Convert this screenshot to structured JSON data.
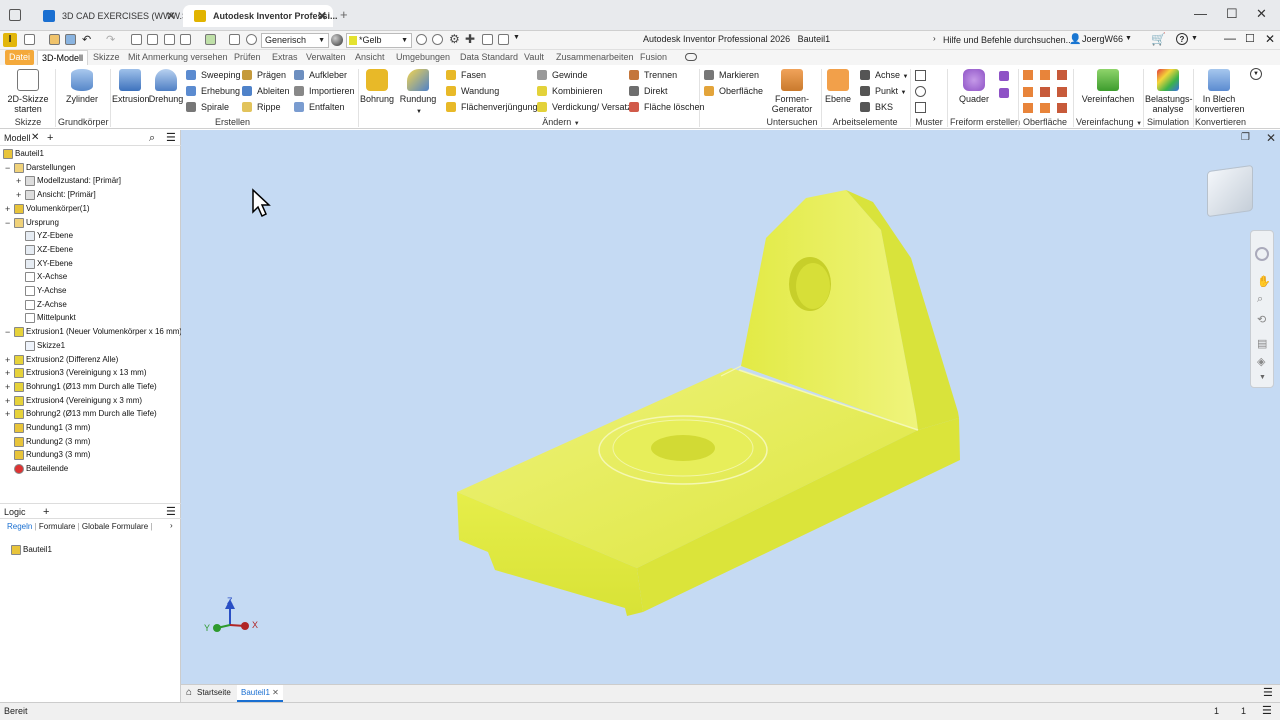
{
  "browser": {
    "tabs": [
      {
        "label": "3D CAD EXERCISES (WWW.S..."
      },
      {
        "label": "Autodesk Inventor Professi..."
      }
    ]
  },
  "app": {
    "title": "Autodesk Inventor Professional 2026",
    "document": "Bauteil1",
    "search_placeholder": "Hilfe und Befehle durchsuchen...",
    "user": "JoergW66"
  },
  "quick_access": {
    "appearance_combo": "Generisch",
    "color_combo": "*Gelb"
  },
  "ribbon_tabs": [
    "Datei",
    "3D-Modell",
    "Skizze",
    "Mit Anmerkung versehen",
    "Prüfen",
    "Extras",
    "Verwalten",
    "Ansicht",
    "Umgebungen",
    "Data Standard",
    "Vault",
    "Zusammenarbeiten",
    "Fusion"
  ],
  "ribbon": {
    "skizze": {
      "sketch_btn": "2D-Skizze starten",
      "group": "Skizze"
    },
    "grundkoerper": {
      "zylinder": "Zylinder",
      "group": "Grundkörper"
    },
    "erstellen": {
      "extrusion": "Extrusion",
      "drehung": "Drehung",
      "sweeping": "Sweeping",
      "erhebung": "Erhebung",
      "spirale": "Spirale",
      "praegen": "Prägen",
      "ableiten": "Ableiten",
      "rippe": "Rippe",
      "aufkleber": "Aufkleber",
      "importieren": "Importieren",
      "entfalten": "Entfalten",
      "group": "Erstellen"
    },
    "aendern": {
      "bohrung": "Bohrung",
      "rundung": "Rundung",
      "fasen": "Fasen",
      "wandung": "Wandung",
      "flaechenverjuengung": "Flächenverjüngung",
      "gewinde": "Gewinde",
      "kombinieren": "Kombinieren",
      "verdickung": "Verdickung/ Versatz",
      "trennen": "Trennen",
      "direkt": "Direkt",
      "flaeche_loeschen": "Fläche löschen",
      "group": "Ändern"
    },
    "untersuchen": {
      "markieren": "Markieren",
      "oberflaeche": "Oberfläche",
      "formen": "Formen-Generator",
      "group": "Untersuchen"
    },
    "arbeitselemente": {
      "ebene": "Ebene",
      "achse": "Achse",
      "punkt": "Punkt",
      "bks": "BKS",
      "group": "Arbeitselemente"
    },
    "muster": {
      "group": "Muster"
    },
    "freiform": {
      "quader": "Quader",
      "group": "Freiform erstellen"
    },
    "oberflaeche_grp": {
      "group": "Oberfläche"
    },
    "vereinfachung": {
      "vereinfachen": "Vereinfachen",
      "group": "Vereinfachung"
    },
    "simulation": {
      "belastung": "Belastungs-analyse",
      "group": "Simulation"
    },
    "konvertieren": {
      "blech": "In Blech konvertieren",
      "group": "Konvertieren"
    }
  },
  "model_browser": {
    "tab": "Modell",
    "tree": [
      {
        "label": "Bauteil1",
        "level": 0,
        "toggle": "",
        "icon": "part-icon"
      },
      {
        "label": "Darstellungen",
        "level": 1,
        "toggle": "−",
        "icon": "folder-icon"
      },
      {
        "label": "Modellzustand: [Primär]",
        "level": 2,
        "toggle": "+",
        "icon": "model-state-icon"
      },
      {
        "label": "Ansicht: [Primär]",
        "level": 2,
        "toggle": "+",
        "icon": "view-icon"
      },
      {
        "label": "Volumenkörper(1)",
        "level": 1,
        "toggle": "+",
        "icon": "solid-bodies-icon"
      },
      {
        "label": "Ursprung",
        "level": 1,
        "toggle": "−",
        "icon": "origin-icon"
      },
      {
        "label": "YZ-Ebene",
        "level": 2,
        "toggle": "",
        "icon": "plane-icon"
      },
      {
        "label": "XZ-Ebene",
        "level": 2,
        "toggle": "",
        "icon": "plane-icon"
      },
      {
        "label": "XY-Ebene",
        "level": 2,
        "toggle": "",
        "icon": "plane-icon"
      },
      {
        "label": "X-Achse",
        "level": 2,
        "toggle": "",
        "icon": "axis-icon"
      },
      {
        "label": "Y-Achse",
        "level": 2,
        "toggle": "",
        "icon": "axis-icon"
      },
      {
        "label": "Z-Achse",
        "level": 2,
        "toggle": "",
        "icon": "axis-icon"
      },
      {
        "label": "Mittelpunkt",
        "level": 2,
        "toggle": "",
        "icon": "center-point-icon"
      },
      {
        "label": "Extrusion1 (Neuer Volumenkörper x 16 mm)",
        "level": 1,
        "toggle": "−",
        "icon": "extrusion-icon"
      },
      {
        "label": "Skizze1",
        "level": 2,
        "toggle": "",
        "icon": "sketch-icon"
      },
      {
        "label": "Extrusion2 (Differenz Alle)",
        "level": 1,
        "toggle": "+",
        "icon": "extrusion-icon"
      },
      {
        "label": "Extrusion3 (Vereinigung x 13 mm)",
        "level": 1,
        "toggle": "+",
        "icon": "extrusion-icon"
      },
      {
        "label": "Bohrung1 (Ø13 mm Durch alle Tiefe)",
        "level": 1,
        "toggle": "+",
        "icon": "hole-icon"
      },
      {
        "label": "Extrusion4 (Vereinigung x 3 mm)",
        "level": 1,
        "toggle": "+",
        "icon": "extrusion-icon"
      },
      {
        "label": "Bohrung2 (Ø13 mm Durch alle Tiefe)",
        "level": 1,
        "toggle": "+",
        "icon": "hole-icon"
      },
      {
        "label": "Rundung1 (3 mm)",
        "level": 1,
        "toggle": "",
        "icon": "fillet-icon"
      },
      {
        "label": "Rundung2 (3 mm)",
        "level": 1,
        "toggle": "",
        "icon": "fillet-icon"
      },
      {
        "label": "Rundung3 (3 mm)",
        "level": 1,
        "toggle": "",
        "icon": "fillet-icon"
      },
      {
        "label": "Bauteilende",
        "level": 1,
        "toggle": "",
        "icon": "end-of-part-icon"
      }
    ]
  },
  "logic_panel": {
    "tab": "Logic",
    "subtabs": [
      "Regeln",
      "Formulare",
      "Globale Formulare"
    ],
    "item": "Bauteil1"
  },
  "triad": {
    "x": "X",
    "y": "Y",
    "z": "Z"
  },
  "doc_tabs": {
    "home": "Startseite",
    "active": "Bauteil1"
  },
  "status": {
    "text": "Bereit",
    "count1": "1",
    "count2": "1"
  },
  "colors": {
    "part": "#e4ec43",
    "viewport": "#c5daf3",
    "file_tab": "#f4a93b"
  }
}
